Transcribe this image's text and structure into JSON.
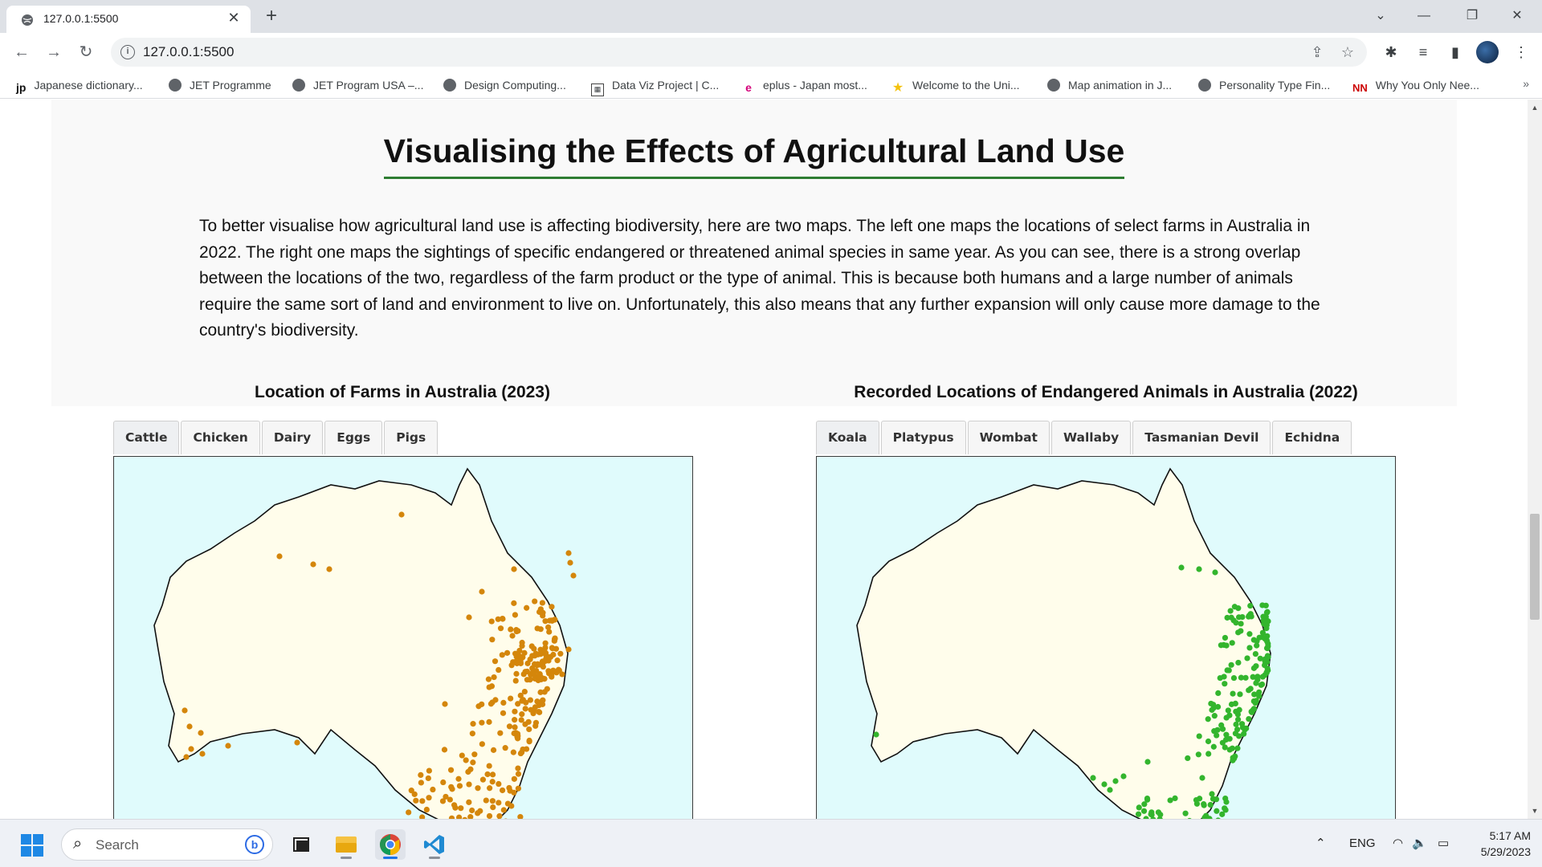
{
  "browser": {
    "tab_title": "127.0.0.1:5500",
    "url": "127.0.0.1:5500",
    "bookmarks": [
      {
        "label": "Japanese dictionary...",
        "icon": "jp-icon"
      },
      {
        "label": "JET Programme",
        "icon": "globe-icon"
      },
      {
        "label": "JET Program USA –...",
        "icon": "globe-icon"
      },
      {
        "label": "Design Computing...",
        "icon": "globe-icon"
      },
      {
        "label": "Data Viz Project | C...",
        "icon": "dataviz-icon"
      },
      {
        "label": "eplus - Japan most...",
        "icon": "eplus-icon"
      },
      {
        "label": "Welcome to the Uni...",
        "icon": "star-icon"
      },
      {
        "label": "Map animation in J...",
        "icon": "globe-icon"
      },
      {
        "label": "Personality Type Fin...",
        "icon": "globe-icon"
      },
      {
        "label": "Why You Only Nee...",
        "icon": "nn-icon"
      }
    ],
    "more_bookmarks": "»"
  },
  "page": {
    "title": "Visualising the Effects of Agricultural Land Use",
    "intro": "To better visualise how agricultural land use is affecting biodiversity, here are two maps. The left one maps the locations of select farms in Australia in 2022. The right one maps the sightings of specific endangered or threatened animal species in same year. As you can see, there is a strong overlap between the locations of the two, regardless of the farm product or the type of animal. This is because both humans and a large number of animals require the same sort of land and environment to live on. Unfortunately, this also means that any further expansion will only cause more damage to the country's biodiversity.",
    "farms_map": {
      "title": "Location of Farms in Australia (2023)",
      "tabs": [
        "Cattle",
        "Chicken",
        "Dairy",
        "Eggs",
        "Pigs"
      ],
      "dot_color": "#d4860b",
      "land_color": "#fffdeb",
      "ocean_color": "#e0fbfc"
    },
    "animals_map": {
      "title": "Recorded Locations of Endangered Animals in Australia (2022)",
      "tabs": [
        "Koala",
        "Platypus",
        "Wombat",
        "Wallaby",
        "Tasmanian Devil",
        "Echidna"
      ],
      "dot_color": "#33b52d",
      "land_color": "#fffdeb",
      "ocean_color": "#e0fbfc"
    }
  },
  "taskbar": {
    "search_label": "Search",
    "language": "ENG",
    "time": "5:17 AM",
    "date": "5/29/2023"
  }
}
